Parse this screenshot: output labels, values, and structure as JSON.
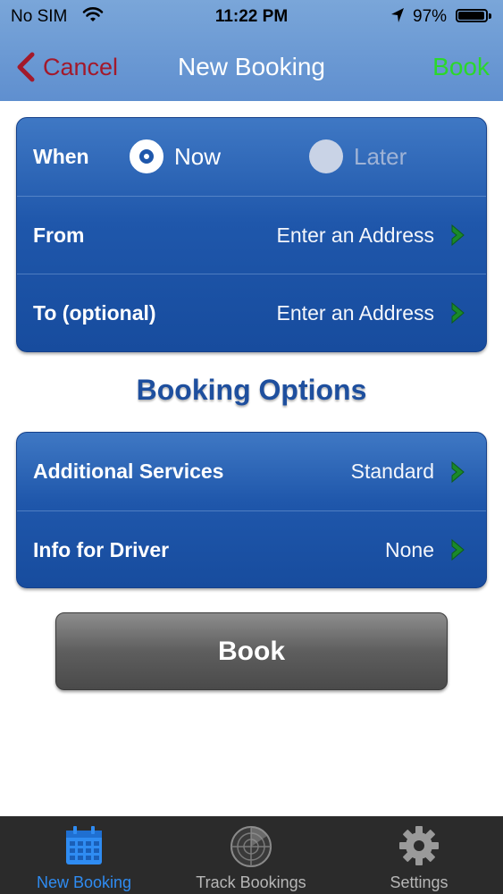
{
  "status_bar": {
    "carrier": "No SIM",
    "time": "11:22 PM",
    "battery": "97%",
    "battery_level": 0.97,
    "icons": [
      "wifi-icon",
      "location-arrow-icon",
      "battery-icon"
    ]
  },
  "nav": {
    "cancel_label": "Cancel",
    "title": "New Booking",
    "book_label": "Book"
  },
  "trip": {
    "when_label": "When",
    "now_label": "Now",
    "later_label": "Later",
    "selected": "Now",
    "from_label": "From",
    "from_value": "Enter an Address",
    "to_label": "To (optional)",
    "to_value": "Enter an Address"
  },
  "options": {
    "title": "Booking Options",
    "services_label": "Additional Services",
    "services_value": "Standard",
    "driver_label": "Info for Driver",
    "driver_value": "None"
  },
  "book_button": "Book",
  "tabs": [
    {
      "label": "New Booking",
      "icon": "calendar-icon",
      "active": true
    },
    {
      "label": "Track Bookings",
      "icon": "radar-icon",
      "active": false
    },
    {
      "label": "Settings",
      "icon": "gear-icon",
      "active": false
    }
  ],
  "colors": {
    "nav_bar": "#6b98d3",
    "cancel": "#a3192b",
    "nav_book": "#2bd82b",
    "panel": "#1f57ab",
    "arrow": "#1a8a2a",
    "tab_active": "#2f8cf2",
    "tab_bar": "#2b2b2b"
  }
}
